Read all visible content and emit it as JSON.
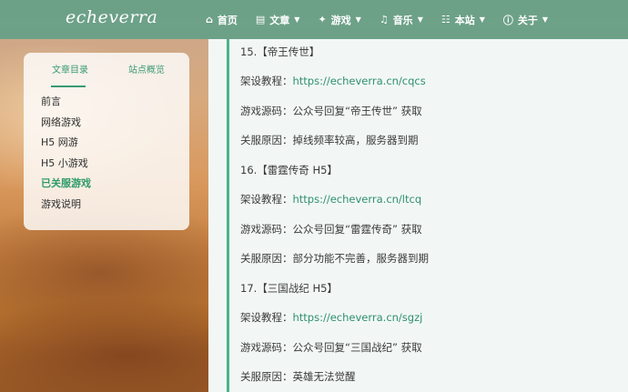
{
  "header": {
    "logo": "echeverra",
    "nav": [
      {
        "icon": "home-icon",
        "glyph": "⌂",
        "label": "首页",
        "dropdown": false
      },
      {
        "icon": "book-icon",
        "glyph": "▤",
        "label": "文章",
        "dropdown": true
      },
      {
        "icon": "gamepad-icon",
        "glyph": "✦",
        "label": "游戏",
        "dropdown": true
      },
      {
        "icon": "music-icon",
        "glyph": "♫",
        "label": "音乐",
        "dropdown": true
      },
      {
        "icon": "sitemap-icon",
        "glyph": "☷",
        "label": "本站",
        "dropdown": true
      },
      {
        "icon": "info-icon",
        "glyph": "ⓘ",
        "label": "关于",
        "dropdown": true
      }
    ],
    "caret": "▼"
  },
  "sidebar": {
    "tabs": [
      "文章目录",
      "站点概览"
    ],
    "toc": [
      {
        "label": "前言",
        "active": false
      },
      {
        "label": "网络游戏",
        "active": false
      },
      {
        "label": "H5 网游",
        "active": false
      },
      {
        "label": "H5 小游戏",
        "active": false
      },
      {
        "label": "已关服游戏",
        "active": true
      },
      {
        "label": "游戏说明",
        "active": false
      }
    ]
  },
  "content": {
    "lines": [
      {
        "type": "heading",
        "text": "15.【帝王传世】"
      },
      {
        "type": "link",
        "prefix": "架设教程：",
        "link": "https://echeverra.cn/cqcs"
      },
      {
        "type": "text",
        "text": "游戏源码：公众号回复“帝王传世” 获取"
      },
      {
        "type": "text",
        "text": "关服原因：掉线频率较高，服务器到期"
      },
      {
        "type": "heading",
        "text": "16.【雷霆传奇 H5】"
      },
      {
        "type": "link",
        "prefix": "架设教程：",
        "link": "https://echeverra.cn/ltcq"
      },
      {
        "type": "text",
        "text": "游戏源码：公众号回复“雷霆传奇” 获取"
      },
      {
        "type": "text",
        "text": "关服原因：部分功能不完善，服务器到期"
      },
      {
        "type": "heading",
        "text": "17.【三国战纪 H5】"
      },
      {
        "type": "link",
        "prefix": "架设教程：",
        "link": "https://echeverra.cn/sgzj"
      },
      {
        "type": "text",
        "text": "游戏源码：公众号回复“三国战纪” 获取"
      },
      {
        "type": "text",
        "text": "关服原因：英雄无法觉醒"
      }
    ]
  },
  "colors": {
    "accent": "#3a9a72",
    "header_bg": "#5ca087",
    "link": "#2f8f72"
  }
}
